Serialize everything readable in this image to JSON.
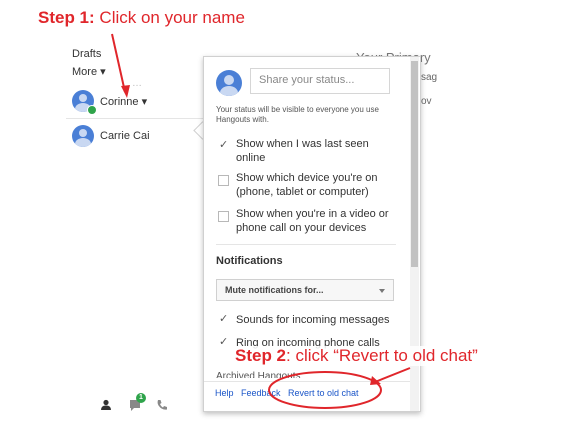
{
  "annotations": {
    "step1_prefix": "Step 1:",
    "step1_text": " Click on your name",
    "step2_prefix": "Step 2",
    "step2_text": ": click “Revert to old chat”"
  },
  "nav": {
    "drafts": "Drafts",
    "more": "More ▾",
    "dots": "…"
  },
  "background": {
    "primary_tab": "Your Primary",
    "frag_1": "sag",
    "frag_2": "ov"
  },
  "contacts": [
    {
      "name": "Corinne ▾"
    },
    {
      "name": "Carrie Cai"
    }
  ],
  "panel": {
    "status_placeholder": "Share your status...",
    "visibility_note": "Your status will be visible to everyone you use Hangouts with.",
    "options": [
      {
        "label": "Show when I was last seen online",
        "checked": true
      },
      {
        "label": "Show which device you're on (phone, tablet or computer)",
        "checked": false
      },
      {
        "label": "Show when you're in a video or phone call on your devices",
        "checked": false
      }
    ],
    "notifications_title": "Notifications",
    "mute_select": "Mute notifications for...",
    "sound_options": [
      {
        "label": "Sounds for incoming messages",
        "checked": true
      },
      {
        "label": "Ring on incoming phone calls",
        "checked": true
      }
    ],
    "archived_label": "Archived Hangouts",
    "footer": {
      "help": "Help",
      "feedback": "Feedback",
      "revert": "Revert to old chat"
    }
  },
  "bottom_bar": {
    "badge_count": "1"
  },
  "colors": {
    "annotation_red": "#e0262b",
    "link_blue": "#1a55c8",
    "avatar_blue": "#4a7fd6",
    "online_green": "#2fa44b"
  }
}
